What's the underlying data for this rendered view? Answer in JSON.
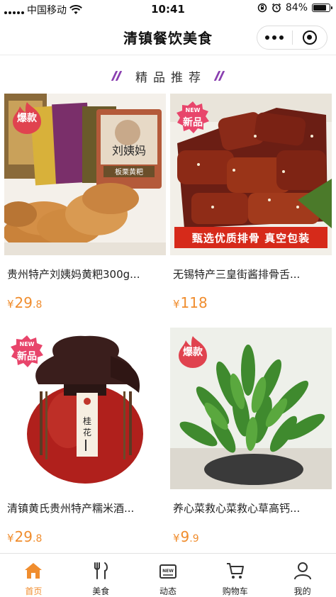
{
  "status_bar": {
    "carrier": "中国移动",
    "time": "10:41",
    "battery": "84%",
    "battery_level": 0.84
  },
  "nav": {
    "title": "清镇餐饮美食"
  },
  "section": {
    "title": "精品推荐"
  },
  "products": [
    {
      "name": "贵州特产刘姨妈黄粑300g...",
      "price_symbol": "¥",
      "price_int": "29",
      "price_dec": ".8",
      "badge": "爆款",
      "badge_type": "hot"
    },
    {
      "name": "无锡特产三皇街酱排骨舌...",
      "price_symbol": "¥",
      "price_int": "118",
      "price_dec": "",
      "badge": "新品",
      "badge_new": "NEW",
      "badge_type": "new",
      "banner": "甄选优质排骨 真空包装"
    },
    {
      "name": "清镇黄氏贵州特产糯米酒...",
      "price_symbol": "¥",
      "price_int": "29",
      "price_dec": ".8",
      "badge": "新品",
      "badge_new": "NEW",
      "badge_type": "new"
    },
    {
      "name": "养心菜救心菜救心草高钙...",
      "price_symbol": "¥",
      "price_int": "9",
      "price_dec": ".9",
      "badge": "爆款",
      "badge_type": "hot"
    }
  ],
  "tabs": [
    {
      "label": "首页",
      "icon": "home-icon",
      "active": true
    },
    {
      "label": "美食",
      "icon": "utensils-icon",
      "active": false
    },
    {
      "label": "动态",
      "icon": "news-icon",
      "active": false
    },
    {
      "label": "购物车",
      "icon": "cart-icon",
      "active": false
    },
    {
      "label": "我的",
      "icon": "user-icon",
      "active": false
    }
  ],
  "colors": {
    "accent": "#f08d2e",
    "badge_red": "#e0434f",
    "badge_pink": "#e8456b",
    "banner_red": "#d62a1a",
    "section_slash": "#8a3fb0"
  }
}
